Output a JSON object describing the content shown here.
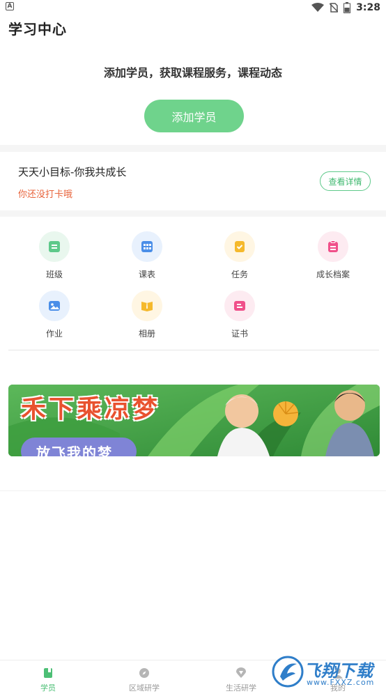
{
  "status_bar": {
    "time": "3:28",
    "left_badge": "A"
  },
  "header": {
    "title": "学习中心"
  },
  "add_student": {
    "promo_text": "添加学员，获取课程服务，课程动态",
    "button_label": "添加学员"
  },
  "goal": {
    "title": "天天小目标-你我共成长",
    "subtitle": "你还没打卡哦",
    "detail_button": "查看详情"
  },
  "grid": {
    "items": [
      {
        "label": "班级",
        "icon": "class-icon",
        "bg": "#e9f7ee",
        "color": "#5ec98a"
      },
      {
        "label": "课表",
        "icon": "schedule-icon",
        "bg": "#e8f1fd",
        "color": "#4a8ee8"
      },
      {
        "label": "任务",
        "icon": "task-icon",
        "bg": "#fff6e3",
        "color": "#f5b92c"
      },
      {
        "label": "成长档案",
        "icon": "growth-record-icon",
        "bg": "#fdebf1",
        "color": "#f0508a"
      },
      {
        "label": "作业",
        "icon": "homework-icon",
        "bg": "#e8f1fd",
        "color": "#4a8ee8"
      },
      {
        "label": "相册",
        "icon": "album-icon",
        "bg": "#fff6e3",
        "color": "#f5b92c"
      },
      {
        "label": "证书",
        "icon": "certificate-icon",
        "bg": "#fdebf1",
        "color": "#f0508a"
      }
    ]
  },
  "banner": {
    "title": "禾下乘凉梦",
    "tag": "放飞我的梦"
  },
  "bottom_nav": {
    "items": [
      {
        "label": "学员",
        "icon": "student-icon",
        "active": true
      },
      {
        "label": "区域研学",
        "icon": "compass-icon",
        "active": false
      },
      {
        "label": "生活研学",
        "icon": "location-icon",
        "active": false
      },
      {
        "label": "我的",
        "icon": "profile-icon",
        "active": false
      }
    ]
  },
  "watermark": {
    "text": "飞翔下载",
    "url": "www.FXXZ.com"
  },
  "colors": {
    "accent": "#6fd38c",
    "warning_text": "#e8643c"
  }
}
